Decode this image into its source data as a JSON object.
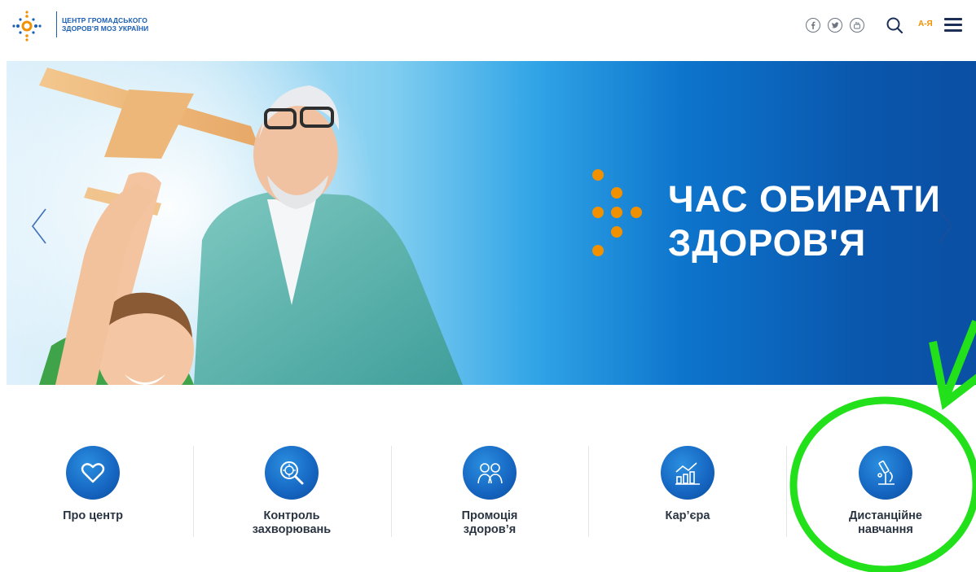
{
  "header": {
    "logo_line1": "ЦЕНТР ГРОМАДСЬКОГО",
    "logo_line2": "ЗДОРОВ'Я МОЗ УКРАЇНИ",
    "az_label": "А-Я",
    "icons": [
      "facebook-icon",
      "twitter-icon",
      "youtube-icon",
      "search-icon",
      "menu-icon"
    ]
  },
  "hero": {
    "title_line1": "ЧАС ОБИРАТИ",
    "title_line2": "ЗДОРОВ'Я"
  },
  "quick_links": [
    {
      "label_1": "Про центр",
      "label_2": "",
      "icon": "heart-icon"
    },
    {
      "label_1": "Контроль",
      "label_2": "захворювань",
      "icon": "virus-magnifier-icon"
    },
    {
      "label_1": "Промоція",
      "label_2": "здоров’я",
      "icon": "people-icon"
    },
    {
      "label_1": "Кар’єра",
      "label_2": "",
      "icon": "chart-icon"
    },
    {
      "label_1": "Дистанційне",
      "label_2": "навчання",
      "icon": "microscope-icon"
    }
  ],
  "colors": {
    "brand_blue": "#1b5fb3",
    "accent_orange": "#f29100",
    "annotation_green": "#22e01a"
  }
}
